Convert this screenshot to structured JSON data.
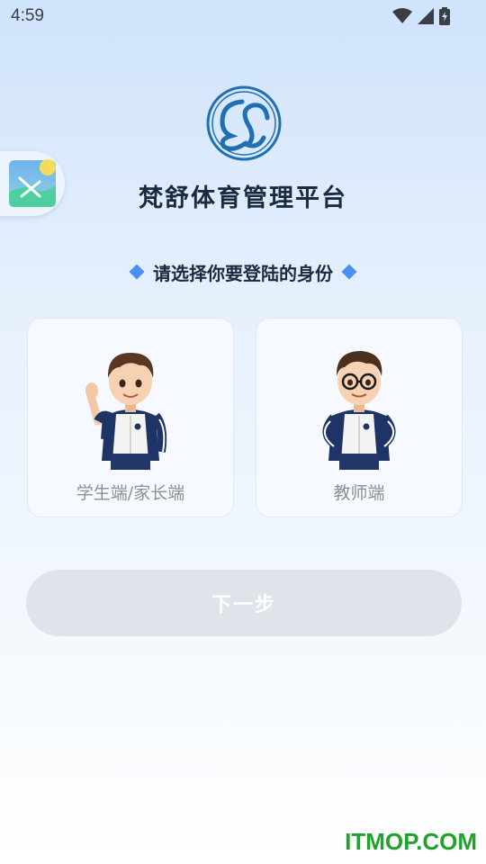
{
  "status_bar": {
    "time": "4:59",
    "icons": [
      "wifi-icon",
      "cellular-signal-icon",
      "battery-charging-icon"
    ]
  },
  "floating_button": {
    "icon": "image-icon"
  },
  "header": {
    "logo": "fanshu-logo",
    "title": "梵舒体育管理平台"
  },
  "prompt": {
    "text": "请选择你要登陆的身份",
    "accent_color": "#4b8ef5"
  },
  "roles": [
    {
      "label": "学生端/家长端",
      "figure": "student-boy-waving"
    },
    {
      "label": "教师端",
      "figure": "teacher-boy-glasses"
    }
  ],
  "next_button": {
    "label": "下一步",
    "state": "disabled"
  },
  "watermark": {
    "text": "ITMOP.COM",
    "color": "#1fa32a"
  }
}
